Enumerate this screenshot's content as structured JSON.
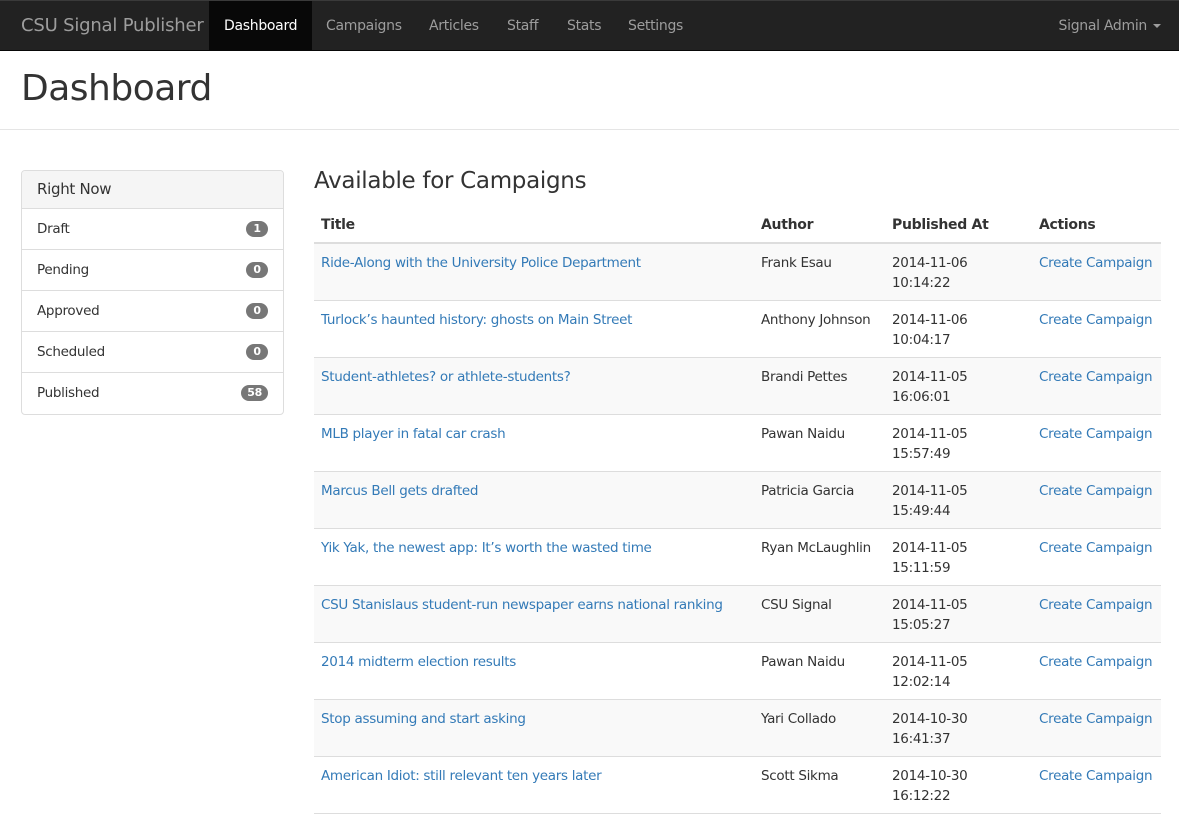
{
  "navbar": {
    "brand": "CSU Signal Publisher",
    "items": [
      {
        "label": "Dashboard",
        "active": true
      },
      {
        "label": "Campaigns",
        "active": false
      },
      {
        "label": "Articles",
        "active": false
      },
      {
        "label": "Staff",
        "active": false
      },
      {
        "label": "Stats",
        "active": false
      },
      {
        "label": "Settings",
        "active": false
      }
    ],
    "user_menu": "Signal Admin"
  },
  "page": {
    "title": "Dashboard"
  },
  "right_now": {
    "heading": "Right Now",
    "items": [
      {
        "label": "Draft",
        "count": "1"
      },
      {
        "label": "Pending",
        "count": "0"
      },
      {
        "label": "Approved",
        "count": "0"
      },
      {
        "label": "Scheduled",
        "count": "0"
      },
      {
        "label": "Published",
        "count": "58"
      }
    ]
  },
  "campaigns": {
    "title": "Available for Campaigns",
    "columns": [
      "Title",
      "Author",
      "Published At",
      "Actions"
    ],
    "rows": [
      {
        "title": "Ride-Along with the University Police Department",
        "author": "Frank Esau",
        "date": "2014-11-06",
        "time": "10:14:22",
        "action": "Create Campaign"
      },
      {
        "title": "Turlock’s haunted history: ghosts on Main Street",
        "author": "Anthony Johnson",
        "date": "2014-11-06",
        "time": "10:04:17",
        "action": "Create Campaign"
      },
      {
        "title": "Student-athletes? or athlete-students?",
        "author": "Brandi Pettes",
        "date": "2014-11-05",
        "time": "16:06:01",
        "action": "Create Campaign"
      },
      {
        "title": "MLB player in fatal car crash",
        "author": "Pawan Naidu",
        "date": "2014-11-05",
        "time": "15:57:49",
        "action": "Create Campaign"
      },
      {
        "title": "Marcus Bell gets drafted",
        "author": "Patricia Garcia",
        "date": "2014-11-05",
        "time": "15:49:44",
        "action": "Create Campaign"
      },
      {
        "title": "Yik Yak, the newest app: It’s worth the wasted time",
        "author": "Ryan McLaughlin",
        "date": "2014-11-05",
        "time": "15:11:59",
        "action": "Create Campaign"
      },
      {
        "title": "CSU Stanislaus student-run newspaper earns national ranking",
        "author": "CSU Signal",
        "date": "2014-11-05",
        "time": "15:05:27",
        "action": "Create Campaign"
      },
      {
        "title": "2014 midterm election results",
        "author": "Pawan Naidu",
        "date": "2014-11-05",
        "time": "12:02:14",
        "action": "Create Campaign"
      },
      {
        "title": "Stop assuming and start asking",
        "author": "Yari Collado",
        "date": "2014-10-30",
        "time": "16:41:37",
        "action": "Create Campaign"
      },
      {
        "title": "American Idiot: still relevant ten years later",
        "author": "Scott Sikma",
        "date": "2014-10-30",
        "time": "16:12:22",
        "action": "Create Campaign"
      }
    ]
  },
  "colors": {
    "navbar_bg": "#222222",
    "navbar_active_bg": "#080808",
    "link": "#337ab7",
    "badge": "#777777"
  }
}
